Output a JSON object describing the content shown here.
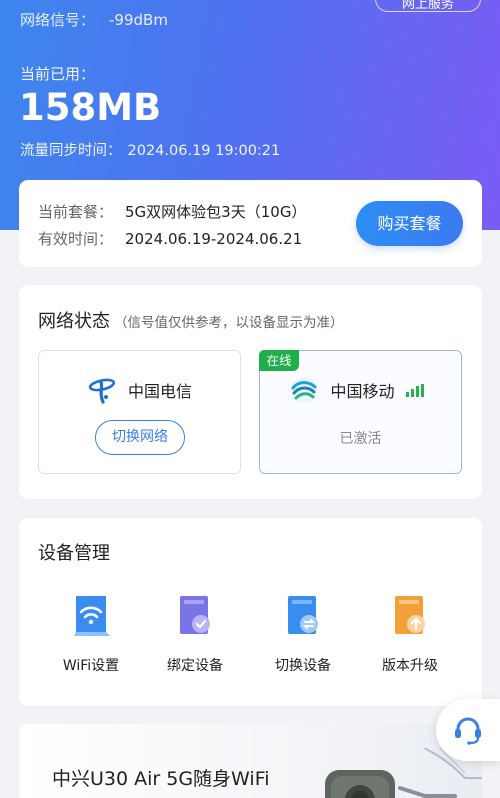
{
  "header": {
    "signal_label": "网络信号：",
    "signal_value": "-99dBm",
    "top_pill_label": "网上服务",
    "used_label": "当前已用：",
    "used_value": "158MB",
    "sync_label": "流量同步时间：",
    "sync_time": "2024.06.19 19:00:21"
  },
  "plan": {
    "package_label": "当前套餐：",
    "package_value": "5G双网体验包3天（10G）",
    "validity_label": "有效时间：",
    "validity_value": "2024.06.19-2024.06.21",
    "buy_button": "购买套餐"
  },
  "network": {
    "title": "网络状态",
    "subtitle": "（信号值仅供参考，以设备显示为准）",
    "carriers": [
      {
        "name": "中国电信",
        "action": "切换网络",
        "icon": "china-telecom-logo"
      },
      {
        "name": "中国移动",
        "status": "已激活",
        "badge": "在线",
        "icon": "china-mobile-logo",
        "signal_level": 4
      }
    ]
  },
  "devices": {
    "title": "设备管理",
    "items": [
      {
        "label": "WiFi设置",
        "icon": "wifi-settings-icon"
      },
      {
        "label": "绑定设备",
        "icon": "bind-device-icon"
      },
      {
        "label": "切换设备",
        "icon": "switch-device-icon"
      },
      {
        "label": "版本升级",
        "icon": "upgrade-icon"
      }
    ]
  },
  "promo": {
    "title": "中兴U30 Air 5G随身WiFi"
  },
  "floating": {
    "icon": "customer-service-icon"
  },
  "colors": {
    "accent": "#3b7ee8",
    "online_green": "#20b04b",
    "hero_gradient_start": "#3d86ee",
    "hero_gradient_end": "#7b5cf4"
  }
}
